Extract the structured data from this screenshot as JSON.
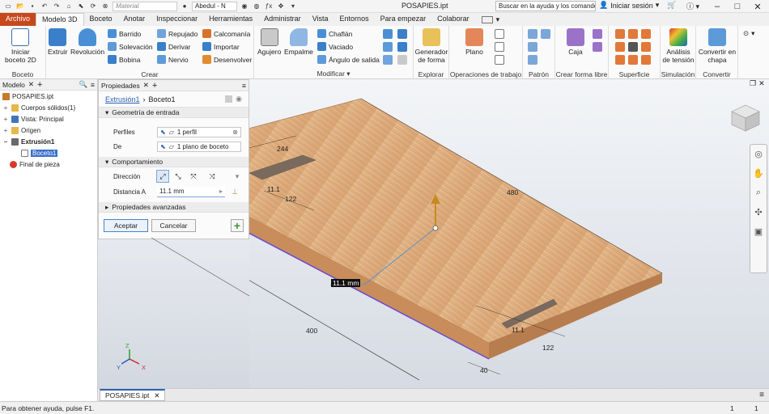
{
  "title": {
    "material": "Material",
    "appearance": "Abedul - N",
    "file": "POSAPIES.ipt",
    "search_placeholder": "Buscar en la ayuda y los comandos",
    "signin": "Iniciar sesión"
  },
  "tabs": [
    "Archivo",
    "Modelo 3D",
    "Boceto",
    "Anotar",
    "Inspeccionar",
    "Herramientas",
    "Administrar",
    "Vista",
    "Entornos",
    "Para empezar",
    "Colaborar"
  ],
  "ribbon": {
    "boceto": {
      "label": "Boceto",
      "start_sketch": [
        "Iniciar",
        "boceto 2D"
      ]
    },
    "crear": {
      "label": "Crear",
      "extruir": "Extruir",
      "revolucion": "Revolución",
      "barrido": "Barrido",
      "solevacion": "Solevación",
      "bobina": "Bobina",
      "repujado": "Repujado",
      "derivar": "Derivar",
      "nervio": "Nervio",
      "calcomania": "Calcomanía",
      "importar": "Importar",
      "desenvolver": "Desenvolver"
    },
    "modificar": {
      "label": "Modificar",
      "agujero": "Agujero",
      "empalme": "Empalme",
      "chaflan": "Chaflán",
      "vaciado": "Vaciado",
      "angulo": "Ángulo de salida"
    },
    "explorar": {
      "label": "Explorar",
      "generador": [
        "Generador",
        "de forma"
      ]
    },
    "operaciones": {
      "label": "Operaciones de trabajo",
      "plano": "Plano"
    },
    "patron": {
      "label": "Patrón"
    },
    "forma_libre": {
      "label": "Crear forma libre",
      "caja": "Caja"
    },
    "superficie": {
      "label": "Superficie"
    },
    "simulacion": {
      "label": "Simulación",
      "analisis": [
        "Análisis",
        "de tensión"
      ]
    },
    "convertir": {
      "label": "Convertir",
      "chapa": [
        "Convertir en",
        "chapa"
      ]
    }
  },
  "browser": {
    "title": "Modelo",
    "items": [
      {
        "label": "POSAPIES.ipt",
        "color": "#c87a2c"
      },
      {
        "label": "Cuerpos sólidos(1)",
        "color": "#e6b84a"
      },
      {
        "label": "Vista: Principal",
        "color": "#3f77b8"
      },
      {
        "label": "Origen",
        "color": "#e6b84a"
      },
      {
        "label": "Extrusión1",
        "color": "#6a6a6a"
      },
      {
        "label": "Boceto1",
        "color": "#7a7a7a"
      },
      {
        "label": "Final de pieza",
        "color": "#d9392b"
      }
    ]
  },
  "properties": {
    "title": "Propiedades",
    "breadcrumb": [
      "Extrusión1",
      "Boceto1"
    ],
    "input_geometry": "Geometría de entrada",
    "profiles_label": "Perfiles",
    "profiles_value": "1 perfil",
    "from_label": "De",
    "from_value": "1 plano de boceto",
    "behavior": "Comportamiento",
    "direction_label": "Dirección",
    "distance_label": "Distancia A",
    "distance_value": "11.1 mm",
    "advanced": "Propiedades avanzadas",
    "ok": "Aceptar",
    "cancel": "Cancelar"
  },
  "viewport": {
    "dims": [
      "244",
      "480",
      "11.1",
      "122",
      "400",
      "11.1",
      "122",
      "40"
    ],
    "input_value": "11.1 mm",
    "triad": [
      "Z",
      "Y",
      "X"
    ]
  },
  "doc_tab": "POSAPIES.ipt",
  "status": {
    "help": "Para obtener ayuda, pulse F1.",
    "n1": "1",
    "n2": "1"
  }
}
